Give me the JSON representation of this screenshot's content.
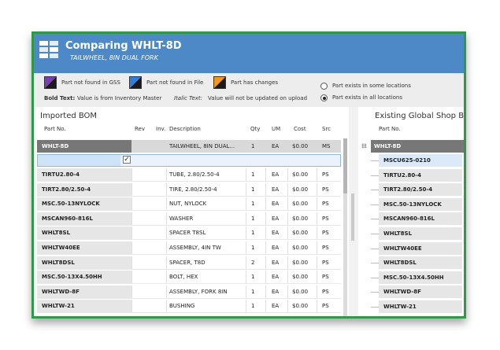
{
  "window": {
    "title": "Comparing WHLT-8D",
    "subtitle": "TAILWHEEL, 8IN DUAL FORK"
  },
  "legend": {
    "items": [
      {
        "label": "Part not found in GSS",
        "color": "#7b3fb5"
      },
      {
        "label": "Part not found in File",
        "color": "#2f7de0"
      },
      {
        "label": "Part has changes",
        "color": "#f39a1e"
      }
    ],
    "bold_key": "Bold Text:",
    "bold_desc": "Value is from Inventory Master",
    "italic_key": "Italic Text:",
    "italic_desc": "Value will not be updated on upload",
    "radio_some": "Part exists in some locations",
    "radio_all": "Part exists in all locations"
  },
  "imported": {
    "title": "Imported BOM",
    "columns": {
      "part": "Part No.",
      "rev": "Rev",
      "inv": "Inv.",
      "desc": "Description",
      "qty": "Qty",
      "um": "UM",
      "cost": "Cost",
      "src": "Src"
    },
    "header_row": {
      "part": "WHLT-8D",
      "desc": "TAILWHEEL, 8IN DUAL...",
      "qty": "1",
      "um": "EA",
      "cost": "$0.00",
      "src": "MS"
    },
    "rows": [
      {
        "part": "TIRTU2.80-4",
        "desc": "TUBE, 2.80/2.50-4",
        "qty": "1",
        "um": "EA",
        "cost": "$0.00",
        "src": "PS"
      },
      {
        "part": "TIRT2.80/2.50-4",
        "desc": "TIRE, 2.80/2.50-4",
        "qty": "1",
        "um": "EA",
        "cost": "$0.00",
        "src": "PS"
      },
      {
        "part": "MSC.50-13NYLOCK",
        "desc": "NUT, NYLOCK",
        "qty": "1",
        "um": "EA",
        "cost": "$0.00",
        "src": "PS"
      },
      {
        "part": "MSCAN960-816L",
        "desc": "WASHER",
        "qty": "1",
        "um": "EA",
        "cost": "$0.00",
        "src": "PS"
      },
      {
        "part": "WHLT8SL",
        "desc": "SPACER T8SL",
        "qty": "1",
        "um": "EA",
        "cost": "$0.00",
        "src": "PS"
      },
      {
        "part": "WHLTW40EE",
        "desc": "ASSEMBLY, 4IN TW",
        "qty": "1",
        "um": "EA",
        "cost": "$0.00",
        "src": "PS"
      },
      {
        "part": "WHLT8DSL",
        "desc": "SPACER, T8D",
        "qty": "2",
        "um": "EA",
        "cost": "$0.00",
        "src": "PS"
      },
      {
        "part": "MSC.50-13X4.50HH",
        "desc": "BOLT, HEX",
        "qty": "1",
        "um": "EA",
        "cost": "$0.00",
        "src": "PS"
      },
      {
        "part": "WHLTWD-8F",
        "desc": "ASSEMBLY, FORK 8IN",
        "qty": "1",
        "um": "EA",
        "cost": "$0.00",
        "src": "PS"
      },
      {
        "part": "WHLTW-21",
        "desc": "BUSHING",
        "qty": "1",
        "um": "EA",
        "cost": "$0.00",
        "src": "PS"
      }
    ]
  },
  "existing": {
    "title": "Existing Global Shop BO",
    "part_col": "Part No.",
    "expand": "⊟",
    "header_row": "WHLT-8D",
    "rows": [
      "MSCU625-0210",
      "TIRTU2.80-4",
      "TIRT2.80/2.50-4",
      "MSC.50-13NYLOCK",
      "MSCAN960-816L",
      "WHLT8SL",
      "WHLTW40EE",
      "WHLT8DSL",
      "MSC.50-13X4.50HH",
      "WHLTWD-8F",
      "WHLTW-21"
    ]
  }
}
